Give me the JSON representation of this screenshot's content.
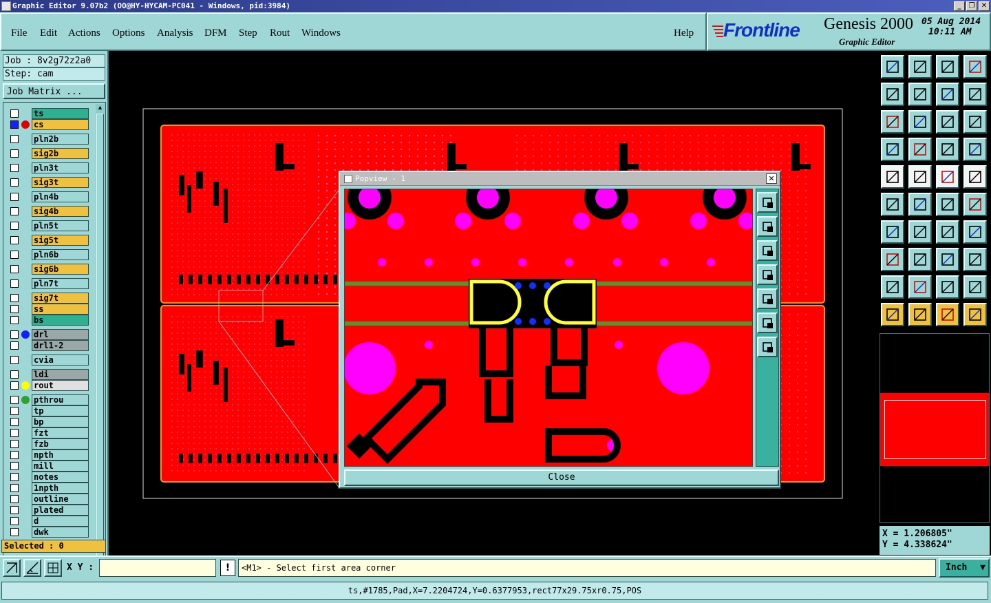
{
  "window": {
    "title": "Graphic Editor 9.07b2  (OO@HY-HYCAM-PC041 - Windows, pid:3984)",
    "minimize": "_",
    "restore": "❐",
    "close": "✕"
  },
  "menu": {
    "items": [
      "File",
      "Edit",
      "Actions",
      "Options",
      "Analysis",
      "DFM",
      "Step",
      "Rout",
      "Windows"
    ],
    "help": "Help"
  },
  "brand": {
    "logo": "Frontline",
    "product": "Genesis 2000",
    "subtitle": "Graphic Editor",
    "date": "05 Aug 2014",
    "time": "10:11 AM"
  },
  "job": {
    "job_label": "Job : 8v2g72z2a0",
    "step_label": "Step: cam",
    "matrix_button": "Job Matrix ..."
  },
  "layers": [
    {
      "name": "ts",
      "color": "#2fb090",
      "dot": ""
    },
    {
      "name": "cs",
      "color": "#f0c040",
      "dot": "#e00000",
      "active": true
    },
    {
      "name": "pln2b",
      "color": "#9fd6d6",
      "dot": ""
    },
    {
      "name": "sig2b",
      "color": "#f0c040",
      "dot": ""
    },
    {
      "name": "pln3t",
      "color": "#9fd6d6",
      "dot": ""
    },
    {
      "name": "sig3t",
      "color": "#f0c040",
      "dot": ""
    },
    {
      "name": "pln4b",
      "color": "#9fd6d6",
      "dot": ""
    },
    {
      "name": "sig4b",
      "color": "#f0c040",
      "dot": ""
    },
    {
      "name": "pln5t",
      "color": "#9fd6d6",
      "dot": ""
    },
    {
      "name": "sig5t",
      "color": "#f0c040",
      "dot": ""
    },
    {
      "name": "pln6b",
      "color": "#9fd6d6",
      "dot": ""
    },
    {
      "name": "sig6b",
      "color": "#f0c040",
      "dot": ""
    },
    {
      "name": "pln7t",
      "color": "#9fd6d6",
      "dot": ""
    },
    {
      "name": "sig7t",
      "color": "#f0c040",
      "dot": ""
    },
    {
      "name": "ss",
      "color": "#f0c040",
      "dot": ""
    },
    {
      "name": "bs",
      "color": "#2fb090",
      "dot": ""
    },
    {
      "name": "drl",
      "color": "#9aa8a8",
      "dot": "#1020ff"
    },
    {
      "name": "drl1-2",
      "color": "#9aa8a8",
      "dot": ""
    },
    {
      "name": "cvia",
      "color": "#9fd6d6",
      "dot": ""
    },
    {
      "name": "ldi",
      "color": "#9aa8a8",
      "dot": ""
    },
    {
      "name": "rout",
      "color": "#e0e0e0",
      "dot": "#ffff00"
    },
    {
      "name": "pthrou",
      "color": "#9fd6d6",
      "dot": "#30a030"
    },
    {
      "name": "tp",
      "color": "#9fd6d6",
      "dot": ""
    },
    {
      "name": "bp",
      "color": "#9fd6d6",
      "dot": ""
    },
    {
      "name": "fzt",
      "color": "#9fd6d6",
      "dot": ""
    },
    {
      "name": "fzb",
      "color": "#9fd6d6",
      "dot": ""
    },
    {
      "name": "npth",
      "color": "#9fd6d6",
      "dot": ""
    },
    {
      "name": "mill",
      "color": "#9fd6d6",
      "dot": ""
    },
    {
      "name": "notes",
      "color": "#9fd6d6",
      "dot": ""
    },
    {
      "name": "1npth",
      "color": "#9fd6d6",
      "dot": ""
    },
    {
      "name": "outline",
      "color": "#9fd6d6",
      "dot": ""
    },
    {
      "name": "plated",
      "color": "#9fd6d6",
      "dot": ""
    },
    {
      "name": "d",
      "color": "#9fd6d6",
      "dot": ""
    },
    {
      "name": "dwk",
      "color": "#9fd6d6",
      "dot": ""
    }
  ],
  "selected": "Selected : 0",
  "popview": {
    "title": "Popview - 1",
    "close_button": "Close"
  },
  "coords": {
    "x": "X = 1.206805\"",
    "y": "Y = 4.338624\""
  },
  "bottom": {
    "xy_label": "X Y :",
    "xy_value": "",
    "prompt": "<M1> - Select first area corner",
    "units": "Inch"
  },
  "status": "ts,#1785,Pad,X=7.2204724,Y=0.6377953,rect77x29.75xr0.75,POS",
  "colors": {
    "panel": "#9fd6d6",
    "board": "#ff0000",
    "pad": "#ff00ff",
    "trace": "#000000"
  }
}
